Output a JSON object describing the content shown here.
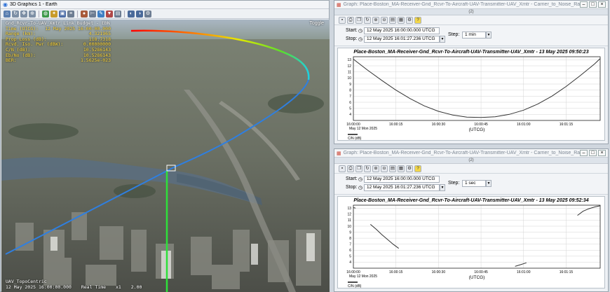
{
  "win3d": {
    "title": "3D Graphics 1 - Earth",
    "hud": {
      "title": "Gnd_Rcvr-To-UAV_Xmtr Link Budget - EBN",
      "rows": [
        {
          "k": "Time (UTCG):",
          "v": "12 May 2025 16:00:00.000"
        },
        {
          "k": "Range (km):",
          "v": "4.321965"
        },
        {
          "k": "Prop Loss (dB):",
          "v": "118.7318"
        },
        {
          "k": "Rcvd. Iso. Pwr (dBW):",
          "v": "0.00000000"
        },
        {
          "k": "C/N (dB):",
          "v": "10.5286143"
        },
        {
          "k": "Eb/No (dB):",
          "v": "10.5286143"
        },
        {
          "k": "BER:",
          "v": "1.5625e-023"
        }
      ]
    },
    "compass": "Toggle",
    "footer": {
      "line1": "UAV_TopoCentric",
      "time": "12 May 2025 16:00:00.000",
      "mode": "Real Time",
      "mult": "x1",
      "fps": "2.00"
    }
  },
  "graph_top": {
    "title": "Graph: Place-Boston_MA-Receiver-Gnd_Rcvr-To-Aircraft-UAV-Transmitter-UAV_Xmtr - Carrier_to_Noise_Ratio",
    "sub": "(2)",
    "start_label": "Start:",
    "stop_label": "Stop:",
    "start_value": "12 May 2025 16:00:00.000 UTCG",
    "stop_value": "12 May 2025 16:01:27.236 UTCG",
    "step_label": "Step:",
    "step_value": "1 min",
    "chart_title": "Place-Boston_MA-Receiver-Gnd_Rcvr-To-Aircraft-UAV-Transmitter-UAV_Xmtr - 13 May 2025 09:50:23",
    "xlabel": "(UTCG)",
    "xdate": "May 12 Mon 2025",
    "legend": "C/N (dB)"
  },
  "graph_bot": {
    "title": "Graph: Place-Boston_MA-Receiver-Gnd_Rcvr-To-Aircraft-UAV-Transmitter-UAV_Xmtr - Carrier_to_Noise_Ratio",
    "sub": "(2)",
    "start_label": "Start:",
    "stop_label": "Stop:",
    "start_value": "12 May 2025 16:00:00.000 UTCG",
    "stop_value": "12 May 2025 16:01:27.236 UTCG",
    "step_label": "Step:",
    "step_value": "1 sec",
    "chart_title": "Place-Boston_MA-Receiver-Gnd_Rcvr-To-Aircraft-UAV-Transmitter-UAV_Xmtr - 13 May 2025 09:52:34",
    "xlabel": "(UTCG)",
    "xdate": "May 12 Mon 2025",
    "legend": "C/N (dB)"
  },
  "colors": {
    "curve": "#333333",
    "grid": "#d4d4d4",
    "hud": "#ffd83a"
  },
  "chart_data": [
    {
      "type": "line",
      "title": "Place-Boston_MA-Receiver-Gnd_Rcvr-To-Aircraft-UAV-Transmitter-UAV_Xmtr - 13 May 2025 09:50:23",
      "xlabel": "(UTCG)",
      "ylabel": "",
      "x_unit": "seconds after 16:00:00",
      "xlim": [
        0,
        87
      ],
      "ylim": [
        3,
        13.5
      ],
      "xticks": [
        {
          "v": 0,
          "label": "16:00:00"
        },
        {
          "v": 15,
          "label": "16:00:15"
        },
        {
          "v": 30,
          "label": "16:00:30"
        },
        {
          "v": 45,
          "label": "16:00:45"
        },
        {
          "v": 60,
          "label": "16:01:00"
        },
        {
          "v": 75,
          "label": "16:01:15"
        }
      ],
      "yticks": [
        4,
        5,
        6,
        7,
        8,
        9,
        10,
        11,
        12,
        13
      ],
      "grid": true,
      "legend": "bottom-left",
      "series": [
        {
          "name": "C/N (dB)",
          "x": [
            0,
            5,
            10,
            15,
            20,
            25,
            30,
            35,
            40,
            45,
            50,
            55,
            60,
            65,
            70,
            75,
            80,
            85,
            87
          ],
          "y": [
            13.1,
            11.3,
            9.6,
            8.0,
            6.6,
            5.4,
            4.5,
            3.9,
            3.55,
            3.5,
            3.6,
            4.0,
            4.7,
            5.7,
            7.0,
            8.6,
            10.4,
            12.3,
            13.2
          ]
        }
      ]
    },
    {
      "type": "line",
      "title": "Place-Boston_MA-Receiver-Gnd_Rcvr-To-Aircraft-UAV-Transmitter-UAV_Xmtr - 13 May 2025 09:52:34",
      "xlabel": "(UTCG)",
      "ylabel": "",
      "x_unit": "seconds after 16:00:00",
      "xlim": [
        0,
        87
      ],
      "ylim": [
        3,
        13.5
      ],
      "xticks": [
        {
          "v": 0,
          "label": "16:00:00"
        },
        {
          "v": 15,
          "label": "16:00:15"
        },
        {
          "v": 30,
          "label": "16:00:30"
        },
        {
          "v": 45,
          "label": "16:00:45"
        },
        {
          "v": 60,
          "label": "16:01:00"
        },
        {
          "v": 75,
          "label": "16:01:15"
        }
      ],
      "yticks": [
        4,
        5,
        6,
        7,
        8,
        9,
        10,
        11,
        12,
        13
      ],
      "grid": true,
      "legend": "bottom-left",
      "series": [
        {
          "name": "C/N (dB)",
          "x": [
            0,
            0.8
          ],
          "y": [
            13.1,
            13.0
          ]
        },
        {
          "name": "C/N (dB)",
          "x": [
            6,
            8,
            10,
            12,
            14,
            16
          ],
          "y": [
            10.3,
            9.5,
            8.6,
            7.8,
            7.0,
            6.3
          ]
        },
        {
          "name": "C/N (dB)",
          "x": [
            57,
            59,
            61
          ],
          "y": [
            3.3,
            3.6,
            3.9
          ]
        },
        {
          "name": "C/N (dB)",
          "x": [
            79,
            81,
            83,
            85,
            87
          ],
          "y": [
            11.8,
            12.5,
            12.9,
            13.2,
            13.4
          ]
        }
      ]
    }
  ]
}
